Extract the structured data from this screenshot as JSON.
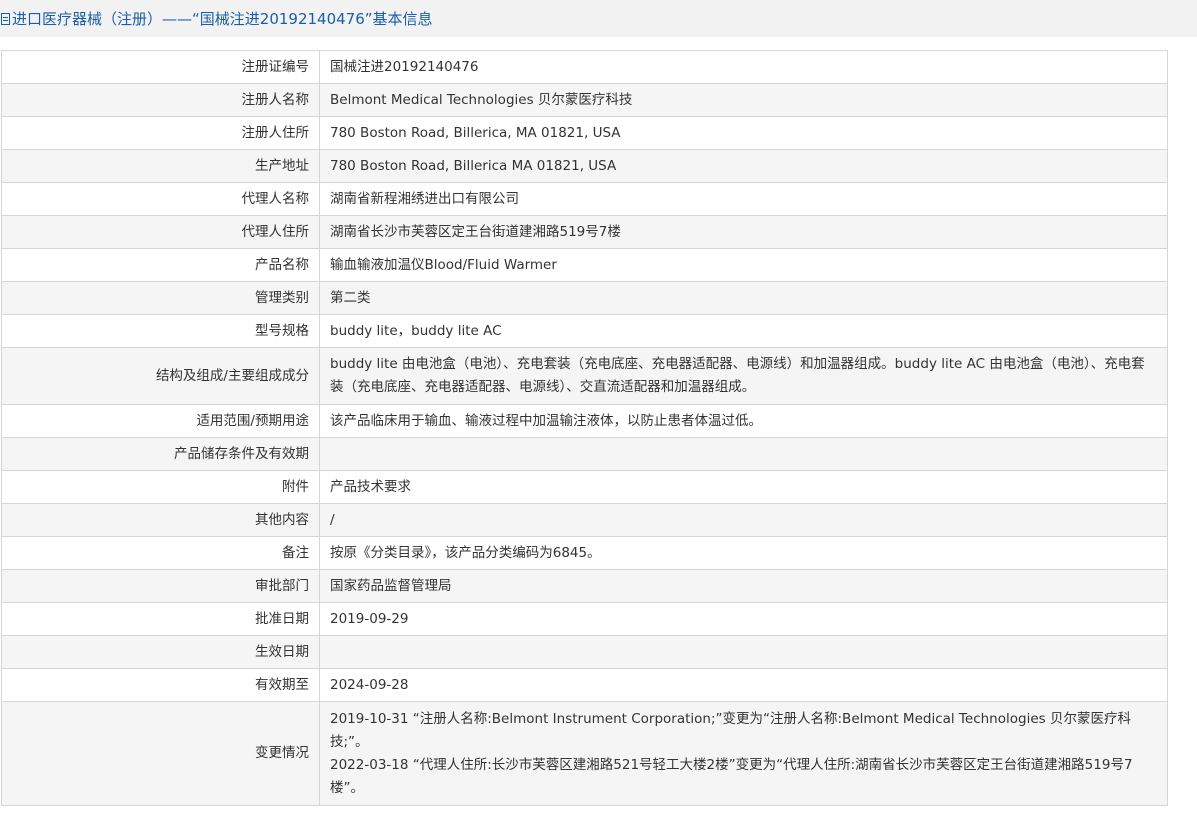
{
  "header": {
    "title": "进口医疗器械（注册）——“国械注进20192140476”基本信息"
  },
  "rows": [
    {
      "label": "注册证编号",
      "value": "国械注进20192140476"
    },
    {
      "label": "注册人名称",
      "value": "Belmont Medical Technologies 贝尔蒙医疗科技"
    },
    {
      "label": "注册人住所",
      "value": "780 Boston Road, Billerica, MA 01821, USA"
    },
    {
      "label": "生产地址",
      "value": "780 Boston Road, Billerica MA 01821, USA"
    },
    {
      "label": "代理人名称",
      "value": "湖南省新程湘绣进出口有限公司"
    },
    {
      "label": "代理人住所",
      "value": "湖南省长沙市芙蓉区定王台街道建湘路519号7楼"
    },
    {
      "label": "产品名称",
      "value": "输血输液加温仪Blood/Fluid Warmer"
    },
    {
      "label": "管理类别",
      "value": "第二类"
    },
    {
      "label": "型号规格",
      "value": "buddy lite，buddy lite AC"
    },
    {
      "label": "结构及组成/主要组成成分",
      "value": "buddy lite 由电池盒（电池）、充电套装（充电底座、充电器适配器、电源线）和加温器组成。buddy lite AC 由电池盒（电池）、充电套装（充电底座、充电器适配器、电源线）、交直流适配器和加温器组成。"
    },
    {
      "label": "适用范围/预期用途",
      "value": "该产品临床用于输血、输液过程中加温输注液体，以防止患者体温过低。"
    },
    {
      "label": "产品储存条件及有效期",
      "value": ""
    },
    {
      "label": "附件",
      "value": "产品技术要求"
    },
    {
      "label": "其他内容",
      "value": "/"
    },
    {
      "label": "备注",
      "value": "按原《分类目录》，该产品分类编码为6845。"
    },
    {
      "label": "审批部门",
      "value": "国家药品监督管理局"
    },
    {
      "label": "批准日期",
      "value": "2019-09-29"
    },
    {
      "label": "生效日期",
      "value": ""
    },
    {
      "label": "有效期至",
      "value": "2024-09-28"
    }
  ],
  "changes": {
    "label": "变更情况",
    "entries": [
      "2019-10-31 “注册人名称:Belmont Instrument Corporation;”变更为“注册人名称:Belmont Medical Technologies 贝尔蒙医疗科技;”。",
      "2022-03-18 “代理人住所:长沙市芙蓉区建湘路521号轻工大楼2楼”变更为“代理人住所:湖南省长沙市芙蓉区定王台街道建湘路519号7楼”。"
    ]
  }
}
